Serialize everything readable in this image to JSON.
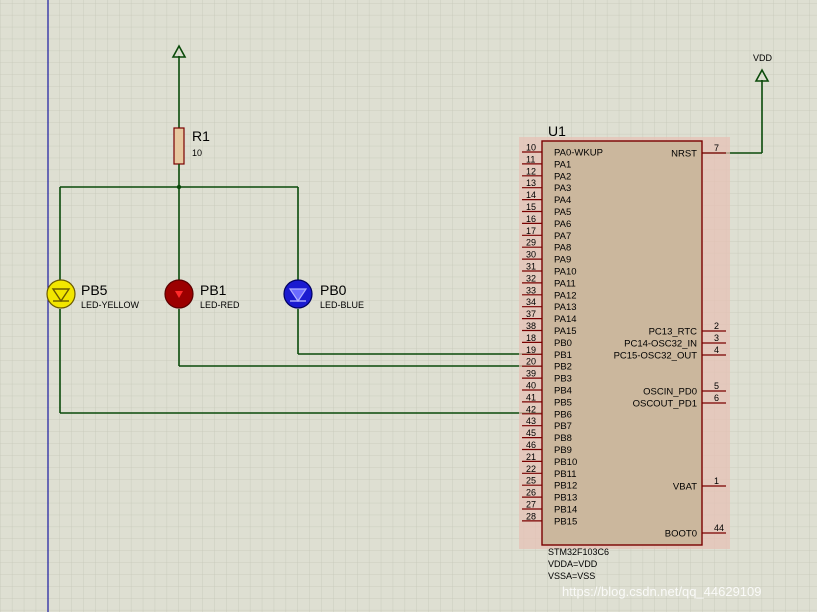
{
  "schematic": {
    "resistor": {
      "ref": "R1",
      "value": "10"
    },
    "leds": [
      {
        "ref": "PB5",
        "type": "LED-YELLOW",
        "fill": "#f2e600",
        "inner": "#f2e600"
      },
      {
        "ref": "PB1",
        "type": "LED-RED",
        "fill": "#9b0000",
        "inner": "#ff2a2a"
      },
      {
        "ref": "PB0",
        "type": "LED-BLUE",
        "fill": "#1a1ad0",
        "inner": "#6a6aff"
      }
    ],
    "vdd_label": "VDD",
    "ic": {
      "ref": "U1",
      "part": "STM32F103C6",
      "notes": [
        "VDDA=VDD",
        "VSSA=VSS"
      ],
      "left_pins": [
        {
          "num": "10",
          "name": "PA0-WKUP"
        },
        {
          "num": "11",
          "name": "PA1"
        },
        {
          "num": "12",
          "name": "PA2"
        },
        {
          "num": "13",
          "name": "PA3"
        },
        {
          "num": "14",
          "name": "PA4"
        },
        {
          "num": "15",
          "name": "PA5"
        },
        {
          "num": "16",
          "name": "PA6"
        },
        {
          "num": "17",
          "name": "PA7"
        },
        {
          "num": "29",
          "name": "PA8"
        },
        {
          "num": "30",
          "name": "PA9"
        },
        {
          "num": "31",
          "name": "PA10"
        },
        {
          "num": "32",
          "name": "PA11"
        },
        {
          "num": "33",
          "name": "PA12"
        },
        {
          "num": "34",
          "name": "PA13"
        },
        {
          "num": "37",
          "name": "PA14"
        },
        {
          "num": "38",
          "name": "PA15"
        },
        {
          "num": "18",
          "name": "PB0"
        },
        {
          "num": "19",
          "name": "PB1"
        },
        {
          "num": "20",
          "name": "PB2"
        },
        {
          "num": "39",
          "name": "PB3"
        },
        {
          "num": "40",
          "name": "PB4"
        },
        {
          "num": "41",
          "name": "PB5"
        },
        {
          "num": "42",
          "name": "PB6"
        },
        {
          "num": "43",
          "name": "PB7"
        },
        {
          "num": "45",
          "name": "PB8"
        },
        {
          "num": "46",
          "name": "PB9"
        },
        {
          "num": "21",
          "name": "PB10"
        },
        {
          "num": "22",
          "name": "PB11"
        },
        {
          "num": "25",
          "name": "PB12"
        },
        {
          "num": "26",
          "name": "PB13"
        },
        {
          "num": "27",
          "name": "PB14"
        },
        {
          "num": "28",
          "name": "PB15"
        }
      ],
      "right_pins": [
        {
          "num": "7",
          "name": "NRST"
        },
        {
          "num": "2",
          "name": "PC13_RTC"
        },
        {
          "num": "3",
          "name": "PC14-OSC32_IN"
        },
        {
          "num": "4",
          "name": "PC15-OSC32_OUT"
        },
        {
          "num": "5",
          "name": "OSCIN_PD0"
        },
        {
          "num": "6",
          "name": "OSCOUT_PD1"
        },
        {
          "num": "1",
          "name": "VBAT"
        },
        {
          "num": "44",
          "name": "BOOT0"
        }
      ]
    },
    "watermark": "https://blog.csdn.net/qq_44629109"
  }
}
